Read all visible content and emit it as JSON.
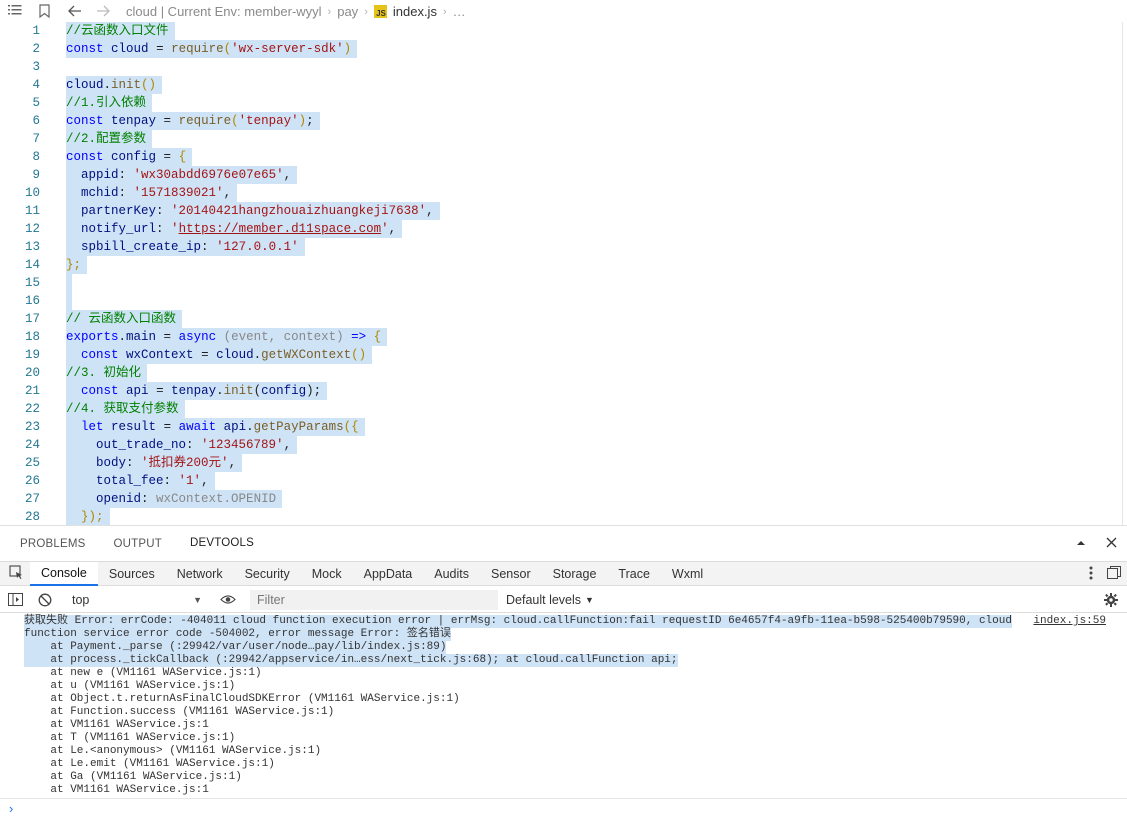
{
  "breadcrumb": {
    "project": "cloud | Current Env: member-wyyl",
    "folder": "pay",
    "file": "index.js",
    "ellipsis": "…",
    "js_badge": "JS"
  },
  "editor": {
    "lines": [
      {
        "n": "1"
      },
      {
        "n": "2"
      },
      {
        "n": "3"
      },
      {
        "n": "4"
      },
      {
        "n": "5"
      },
      {
        "n": "6"
      },
      {
        "n": "7"
      },
      {
        "n": "8"
      },
      {
        "n": "9"
      },
      {
        "n": "10"
      },
      {
        "n": "11"
      },
      {
        "n": "12"
      },
      {
        "n": "13"
      },
      {
        "n": "14"
      },
      {
        "n": "15"
      },
      {
        "n": "16"
      },
      {
        "n": "17"
      },
      {
        "n": "18"
      },
      {
        "n": "19"
      },
      {
        "n": "20"
      },
      {
        "n": "21"
      },
      {
        "n": "22"
      },
      {
        "n": "23"
      },
      {
        "n": "24"
      },
      {
        "n": "25"
      },
      {
        "n": "26"
      },
      {
        "n": "27"
      },
      {
        "n": "28"
      }
    ],
    "code": {
      "l1_comment": "//云函数入口文件",
      "l2_const": "const",
      "l2_name": "cloud",
      "l2_eq": "=",
      "l2_fn": "require",
      "l2_str": "'wx-server-sdk'",
      "l4_obj": "cloud",
      "l4_fn": "init",
      "l5_comment": "//1.引入依赖",
      "l6_const": "const",
      "l6_name": "tenpay",
      "l6_fn": "require",
      "l6_str": "'tenpay'",
      "l7_comment": "//2.配置参数",
      "l8_const": "const",
      "l8_name": "config",
      "l9_key": "appid",
      "l9_val": "'wx30abdd6976e07e65'",
      "l10_key": "mchid",
      "l10_val": "'1571839021'",
      "l11_key": "partnerKey",
      "l11_val": "'20140421hangzhouaizhuangkeji7638'",
      "l12_key": "notify_url",
      "l12_val": "https://member.d11space.com",
      "l13_key": "spbill_create_ip",
      "l13_val": "'127.0.0.1'",
      "l14_close": "};",
      "l17_comment": "// 云函数入口函数",
      "l18_exports": "exports",
      "l18_main": "main",
      "l18_async": "async",
      "l18_params": "(event, context)",
      "l18_arrow": "=>",
      "l19_const": "const",
      "l19_name": "wxContext",
      "l19_obj": "cloud",
      "l19_fn": "getWXContext",
      "l20_comment": "//3. 初始化",
      "l21_const": "const",
      "l21_name": "api",
      "l21_obj": "tenpay",
      "l21_fn": "init",
      "l21_arg": "config",
      "l22_comment": "//4. 获取支付参数",
      "l23_let": "let",
      "l23_name": "result",
      "l23_await": "await",
      "l23_obj": "api",
      "l23_fn": "getPayParams",
      "l24_key": "out_trade_no",
      "l24_val": "'123456789'",
      "l25_key": "body",
      "l25_val": "'抵扣券200元'",
      "l26_key": "total_fee",
      "l26_val": "'1'",
      "l27_key": "openid",
      "l27_val": "wxContext.OPENID",
      "l28_close": "});"
    }
  },
  "panel_tabs": [
    "PROBLEMS",
    "OUTPUT",
    "DEVTOOLS"
  ],
  "devtools_tabs": [
    "Console",
    "Sources",
    "Network",
    "Security",
    "Mock",
    "AppData",
    "Audits",
    "Sensor",
    "Storage",
    "Trace",
    "Wxml"
  ],
  "console_toolbar": {
    "context": "top",
    "filter_placeholder": "Filter",
    "levels": "Default levels"
  },
  "console": {
    "source_link": "index.js:59",
    "lines": [
      "获取失败 Error: errCode: -404011 cloud function execution error | errMsg: cloud.callFunction:fail requestID 6e4657f4-a9fb-11ea-b598-525400b79590, cloud",
      "function service error code -504002, error message Error: 签名错误",
      "    at Payment._parse (:29942/var/user/node…pay/lib/index.js:89)",
      "    at process._tickCallback (:29942/appservice/in…ess/next_tick.js:68); at cloud.callFunction api;",
      "    at new e (VM1161 WAService.js:1)",
      "    at u (VM1161 WAService.js:1)",
      "    at Object.t.returnAsFinalCloudSDKError (VM1161 WAService.js:1)",
      "    at Function.success (VM1161 WAService.js:1)",
      "    at VM1161 WAService.js:1",
      "    at T (VM1161 WAService.js:1)",
      "    at Le.<anonymous> (VM1161 WAService.js:1)",
      "    at Le.emit (VM1161 WAService.js:1)",
      "    at Ga (VM1161 WAService.js:1)",
      "    at VM1161 WAService.js:1"
    ],
    "prompt": "›"
  },
  "colors": {
    "selection": "#cfe3f7",
    "line_number": "#237893",
    "keyword": "#0000ff",
    "string": "#a31515",
    "comment": "#008000",
    "active_tab_underline": "#1a73e8"
  },
  "icons": [
    "list-icon",
    "bookmark-icon",
    "back-arrow-icon",
    "forward-arrow-icon",
    "chevron-up-icon",
    "close-icon",
    "inspect-icon",
    "kebab-menu-icon",
    "dock-icon",
    "sidebar-toggle-icon",
    "clear-console-icon",
    "eye-icon",
    "gear-icon"
  ]
}
